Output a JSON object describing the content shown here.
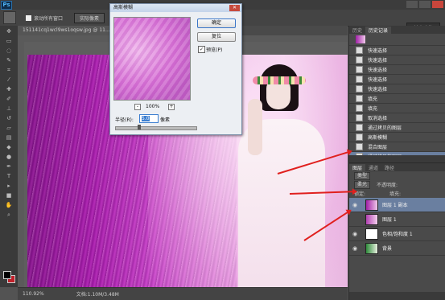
{
  "app": {
    "logo": "Ps",
    "menu": [
      "",
      "",
      "",
      "",
      "",
      "",
      "",
      "",
      "",
      "",
      ""
    ]
  },
  "options_bar": {
    "checkbox_label": "滚动所有窗口",
    "button_label": "实际像素",
    "workspace": "基本功能"
  },
  "document": {
    "tab_title": "151141cq1wcl9ws1oqsw.jpg @ 11...",
    "zoom": "110.92%",
    "doc_info": "文档:1.10M/3.48M"
  },
  "dialog": {
    "title": "高斯模糊",
    "ok_label": "确定",
    "reset_label": "复位",
    "preview_label": "预览(P)",
    "preview_checked": "✓",
    "zoom_level": "100%",
    "zoom_minus": "-",
    "zoom_plus": "+",
    "radius_label": "半径(R):",
    "radius_value": "5.0",
    "radius_unit": "像素"
  },
  "history_panel": {
    "tabs": [
      "历史",
      "历史记录"
    ],
    "items": [
      {
        "label": "快速选择"
      },
      {
        "label": "快速选择"
      },
      {
        "label": "快速选择"
      },
      {
        "label": "快速选择"
      },
      {
        "label": "快速选择"
      },
      {
        "label": "填充"
      },
      {
        "label": "填充"
      },
      {
        "label": "取消选择"
      },
      {
        "label": "通过拷贝的图层"
      },
      {
        "label": "高斯模糊"
      },
      {
        "label": "混合图层"
      },
      {
        "label": "通过拷贝的图层"
      }
    ]
  },
  "layers_panel": {
    "tabs": [
      "图层",
      "通道",
      "路径"
    ],
    "kind_label": "类型",
    "blend_mode": "柔光",
    "opacity_label": "不透明度:",
    "lock_label": "锁定:",
    "fill_label": "填充:",
    "layers": [
      {
        "name": "图层 1 副本",
        "active": true
      },
      {
        "name": "图层 1",
        "active": false
      },
      {
        "name": "色相/饱和度 1",
        "active": false
      },
      {
        "name": "背景",
        "active": false
      }
    ]
  },
  "colors": {
    "foreground": "#000000",
    "background": "#c0202a",
    "accent": "#3c7fd0",
    "arrow": "#e0201e"
  }
}
